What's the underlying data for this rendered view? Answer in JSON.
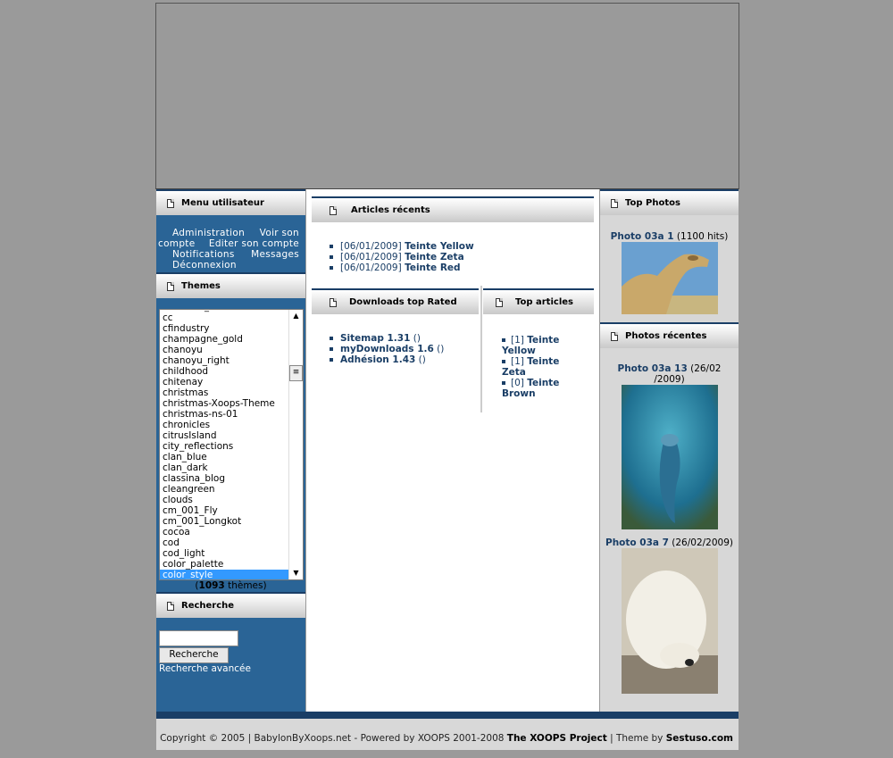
{
  "left": {
    "user_menu_title": "Menu utilisateur",
    "user_menu": [
      "Administration",
      "Voir son compte",
      "Editer son compte",
      "Notifications",
      "Messages",
      "Déconnexion"
    ],
    "themes_title": "Themes",
    "themes_partial_top": "_",
    "themes": [
      "cc",
      "cfindustry",
      "champagne_gold",
      "chanoyu",
      "chanoyu_right",
      "childhood",
      "chitenay",
      "christmas",
      "christmas-Xoops-Theme",
      "christmas-ns-01",
      "chronicles",
      "citrusIsland",
      "city_reflections",
      "clan_blue",
      "clan_dark",
      "classina_blog",
      "cleangreen",
      "clouds",
      "cm_001_Fly",
      "cm_001_Longkot",
      "cocoa",
      "cod",
      "cod_light",
      "color_palette",
      "color_style"
    ],
    "selected_theme": "color_style",
    "themes_count_number": "1093",
    "themes_count_suffix": " thèmes)",
    "themes_count_prefix": "(",
    "search_title": "Recherche",
    "search_button": "Recherche",
    "search_value": "",
    "advanced_search": "Recherche avancée"
  },
  "center": {
    "recent_articles_title": "Articles récents",
    "recent_articles": [
      {
        "date": "[06/01/2009]",
        "title": "Teinte Yellow"
      },
      {
        "date": "[06/01/2009]",
        "title": "Teinte Zeta"
      },
      {
        "date": "[06/01/2009]",
        "title": "Teinte Red"
      }
    ],
    "downloads_title": "Downloads top Rated",
    "downloads": [
      {
        "title": "Sitemap 1.31",
        "suffix": " ()"
      },
      {
        "title": "myDownloads 1.6",
        "suffix": " ()"
      },
      {
        "title": "Adhésion 1.43",
        "suffix": " ()"
      }
    ],
    "top_articles_title": "Top articles",
    "top_articles": [
      {
        "count": "[1]",
        "title_a": "Teinte",
        "title_b": "Yellow"
      },
      {
        "count": "[1]",
        "title_a": "Teinte",
        "title_b": "Zeta"
      },
      {
        "count": "[0]",
        "title_a": "Teinte",
        "title_b": "Brown"
      }
    ]
  },
  "right": {
    "top_photos_title": "Top Photos",
    "top_photo": {
      "title": "Photo 03a 1",
      "meta": " (1100 hits)"
    },
    "recent_photos_title": "Photos récentes",
    "recent_photo_1": {
      "title": "Photo 03a 13",
      "meta_a": " (26/02",
      "meta_b": "/2009)"
    },
    "recent_photo_2": {
      "title": "Photo 03a 7",
      "meta": " (26/02/2009)"
    }
  },
  "footer": {
    "text": "Copyright © 2005 | BabylonByXoops.net - Powered by XOOPS 2001-2008 ",
    "project": "The XOOPS Project",
    "sep": " | Theme by ",
    "author": "Sestuso.com"
  },
  "colors": {
    "sidebar": "#2a6496",
    "accent": "#1a3e66",
    "selected": "#3399ff"
  }
}
